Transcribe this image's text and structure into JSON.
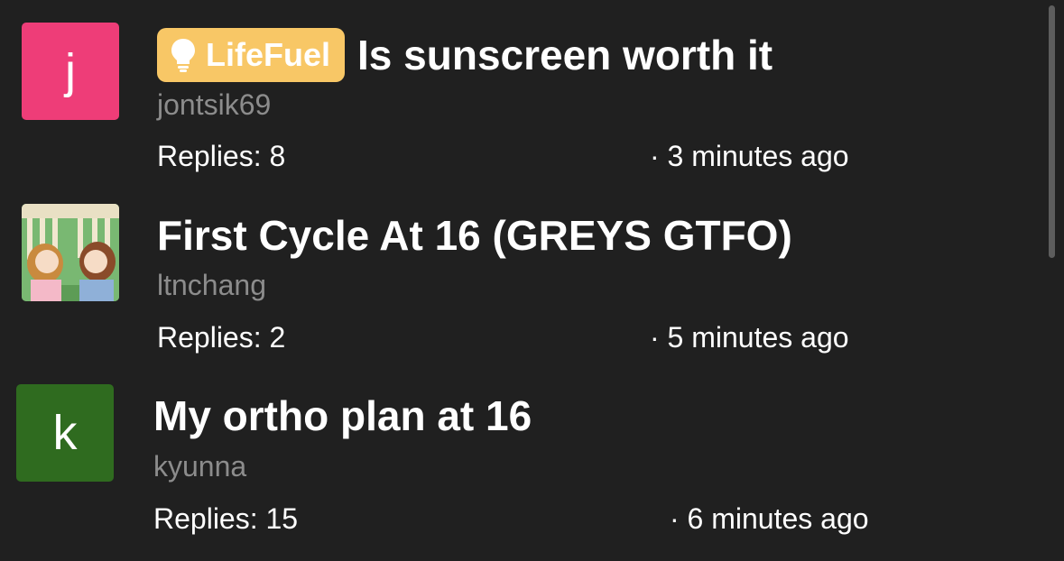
{
  "threads": [
    {
      "avatar_letter": "j",
      "avatar_color": "#ee3d78",
      "tag": {
        "label": "LifeFuel",
        "icon": "lightbulb-icon",
        "color": "#f8c766"
      },
      "title": "Is sunscreen worth it",
      "author": "jontsik69",
      "replies": "Replies: 8",
      "time": "· 3 minutes ago"
    },
    {
      "avatar_letter": "",
      "avatar_image": "anime-illustration",
      "title": "First Cycle At 16 (GREYS GTFO)",
      "author": "ltnchang",
      "replies": "Replies: 2",
      "time": "· 5 minutes ago"
    },
    {
      "avatar_letter": "k",
      "avatar_color": "#2f6b1f",
      "title": "My ortho plan at 16",
      "author": "kyunna",
      "replies": "Replies: 15",
      "time": "· 6 minutes ago"
    }
  ]
}
